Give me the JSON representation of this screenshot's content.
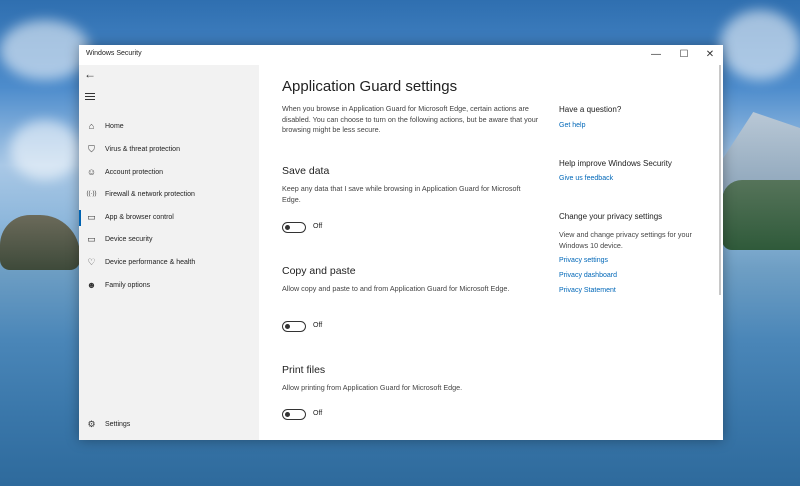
{
  "window": {
    "title": "Windows Security",
    "controls": {
      "minimize": "—",
      "maximize": "☐",
      "close": "✕"
    }
  },
  "sidebar": {
    "items": [
      {
        "label": "Home",
        "icon": "home-icon",
        "glyph": "⌂"
      },
      {
        "label": "Virus & threat protection",
        "icon": "shield-icon",
        "glyph": "⛉"
      },
      {
        "label": "Account protection",
        "icon": "person-icon",
        "glyph": "☺"
      },
      {
        "label": "Firewall & network protection",
        "icon": "wifi-icon",
        "glyph": "((·))"
      },
      {
        "label": "App & browser control",
        "icon": "app-window-icon",
        "glyph": "▭"
      },
      {
        "label": "Device security",
        "icon": "laptop-icon",
        "glyph": "▭"
      },
      {
        "label": "Device performance & health",
        "icon": "heart-icon",
        "glyph": "♡"
      },
      {
        "label": "Family options",
        "icon": "family-icon",
        "glyph": "☻"
      }
    ],
    "settings": {
      "label": "Settings",
      "icon": "gear-icon",
      "glyph": "⚙"
    }
  },
  "main": {
    "title": "Application Guard settings",
    "intro": "When you browse in Application Guard for Microsoft Edge, certain actions are disabled. You can choose to turn on the following actions, but be aware that your browsing might be less secure.",
    "sections": [
      {
        "title": "Save data",
        "desc": "Keep any data that I save while browsing in Application Guard for Microsoft Edge.",
        "toggle": "Off"
      },
      {
        "title": "Copy and paste",
        "desc": "Allow copy and paste to and from Application Guard for Microsoft Edge.",
        "toggle": "Off"
      },
      {
        "title": "Print files",
        "desc": "Allow printing from Application Guard for Microsoft Edge.",
        "toggle": "Off"
      }
    ]
  },
  "right": {
    "question": {
      "heading": "Have a question?",
      "link": "Get help"
    },
    "improve": {
      "heading": "Help improve Windows Security",
      "link": "Give us feedback"
    },
    "privacy": {
      "heading": "Change your privacy settings",
      "desc": "View and change privacy settings for your Windows 10 device.",
      "links": [
        "Privacy settings",
        "Privacy dashboard",
        "Privacy Statement"
      ]
    }
  }
}
